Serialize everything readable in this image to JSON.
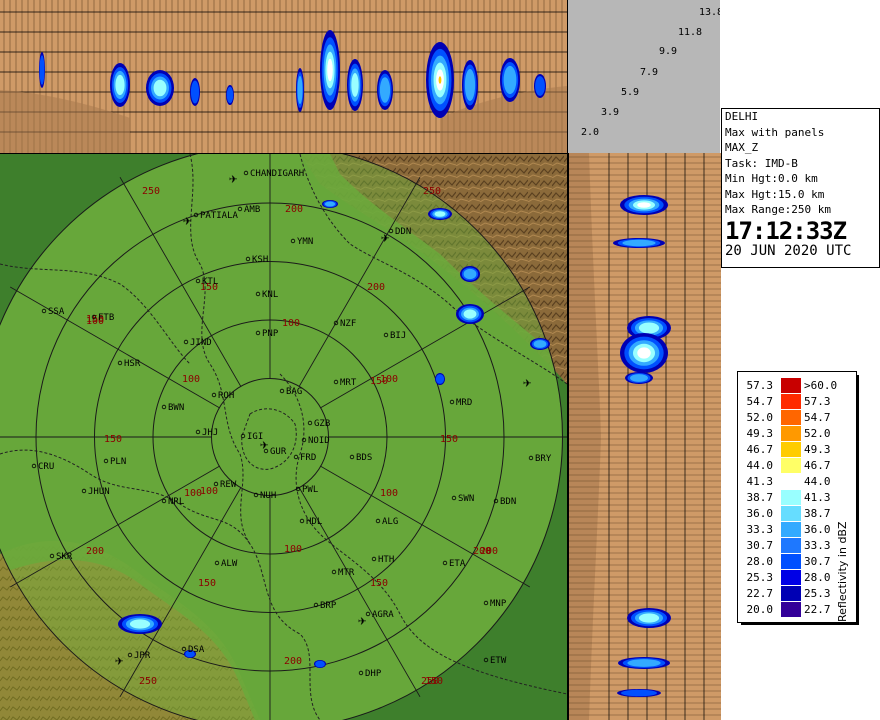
{
  "station": {
    "name": "DELHI",
    "product_line": "Max with panels",
    "product": "MAX_Z",
    "task": "Task: IMD-B",
    "min_hgt": "Min Hgt:0.0 km",
    "max_hgt": "Max Hgt:15.0 km",
    "max_range": "Max Range:250 km",
    "time": "17:12:33Z",
    "date": "20 JUN 2020 UTC"
  },
  "height_labels": [
    "13.8",
    "11.8",
    "9.9",
    "7.9",
    "5.9",
    "3.9",
    "2.0"
  ],
  "legend": {
    "title": "Reflectivity in dBZ",
    "rows": [
      {
        "low": "57.3",
        "color": "#c80000",
        "high": ">60.0"
      },
      {
        "low": "54.7",
        "color": "#ff2a00",
        "high": "57.3"
      },
      {
        "low": "52.0",
        "color": "#ff6600",
        "high": "54.7"
      },
      {
        "low": "49.3",
        "color": "#ff9900",
        "high": "52.0"
      },
      {
        "low": "46.7",
        "color": "#ffcc00",
        "high": "49.3"
      },
      {
        "low": "44.0",
        "color": "#ffff66",
        "high": "46.7"
      },
      {
        "low": "41.3",
        "color": "#ffffff",
        "high": "44.0"
      },
      {
        "low": "38.7",
        "color": "#99ffff",
        "high": "41.3"
      },
      {
        "low": "36.0",
        "color": "#66ddff",
        "high": "38.7"
      },
      {
        "low": "33.3",
        "color": "#33aaff",
        "high": "36.0"
      },
      {
        "low": "30.7",
        "color": "#1e78ff",
        "high": "33.3"
      },
      {
        "low": "28.0",
        "color": "#0050ff",
        "high": "30.7"
      },
      {
        "low": "25.3",
        "color": "#0000e6",
        "high": "28.0"
      },
      {
        "low": "22.7",
        "color": "#0000b4",
        "high": "25.3"
      },
      {
        "low": "20.0",
        "color": "#330099",
        "high": "22.7"
      }
    ]
  },
  "map": {
    "range_labels": [
      "250",
      "200",
      "150",
      "100",
      "250",
      "200",
      "150",
      "100",
      "150",
      "100",
      "100",
      "150",
      "100",
      "150",
      "200",
      "100",
      "150",
      "200",
      "250",
      "200",
      "150",
      "100",
      "100",
      "150",
      "200",
      "250"
    ],
    "cities": [
      {
        "label": "CHANDIGARH"
      },
      {
        "label": "AMB"
      },
      {
        "label": "PATIALA"
      },
      {
        "label": "DDN"
      },
      {
        "label": "YMN"
      },
      {
        "label": "KSH"
      },
      {
        "label": "KTL"
      },
      {
        "label": "KNL"
      },
      {
        "label": "FTB"
      },
      {
        "label": "SSA"
      },
      {
        "label": "PNP"
      },
      {
        "label": "NZF"
      },
      {
        "label": "BIJ"
      },
      {
        "label": "JIND"
      },
      {
        "label": "HSR"
      },
      {
        "label": "MRT"
      },
      {
        "label": "BAG"
      },
      {
        "label": "ROH"
      },
      {
        "label": "BWN"
      },
      {
        "label": "GZB"
      },
      {
        "label": "MRD"
      },
      {
        "label": "JHJ"
      },
      {
        "label": "IGI"
      },
      {
        "label": "NOID"
      },
      {
        "label": "GUR"
      },
      {
        "label": "FRD"
      },
      {
        "label": "BDS"
      },
      {
        "label": "CRU"
      },
      {
        "label": "PLN"
      },
      {
        "label": "BRY"
      },
      {
        "label": "JHUN"
      },
      {
        "label": "REW"
      },
      {
        "label": "NUH"
      },
      {
        "label": "PWL"
      },
      {
        "label": "SWN"
      },
      {
        "label": "BDN"
      },
      {
        "label": "NRL"
      },
      {
        "label": "HDL"
      },
      {
        "label": "ALG"
      },
      {
        "label": "SKR"
      },
      {
        "label": "HTH"
      },
      {
        "label": "ETA"
      },
      {
        "label": "ALW"
      },
      {
        "label": "MTR"
      },
      {
        "label": "BRP"
      },
      {
        "label": "AGRA"
      },
      {
        "label": "MNP"
      },
      {
        "label": "JPR"
      },
      {
        "label": "DSA"
      },
      {
        "label": "DHP"
      },
      {
        "label": "ETW"
      }
    ]
  }
}
